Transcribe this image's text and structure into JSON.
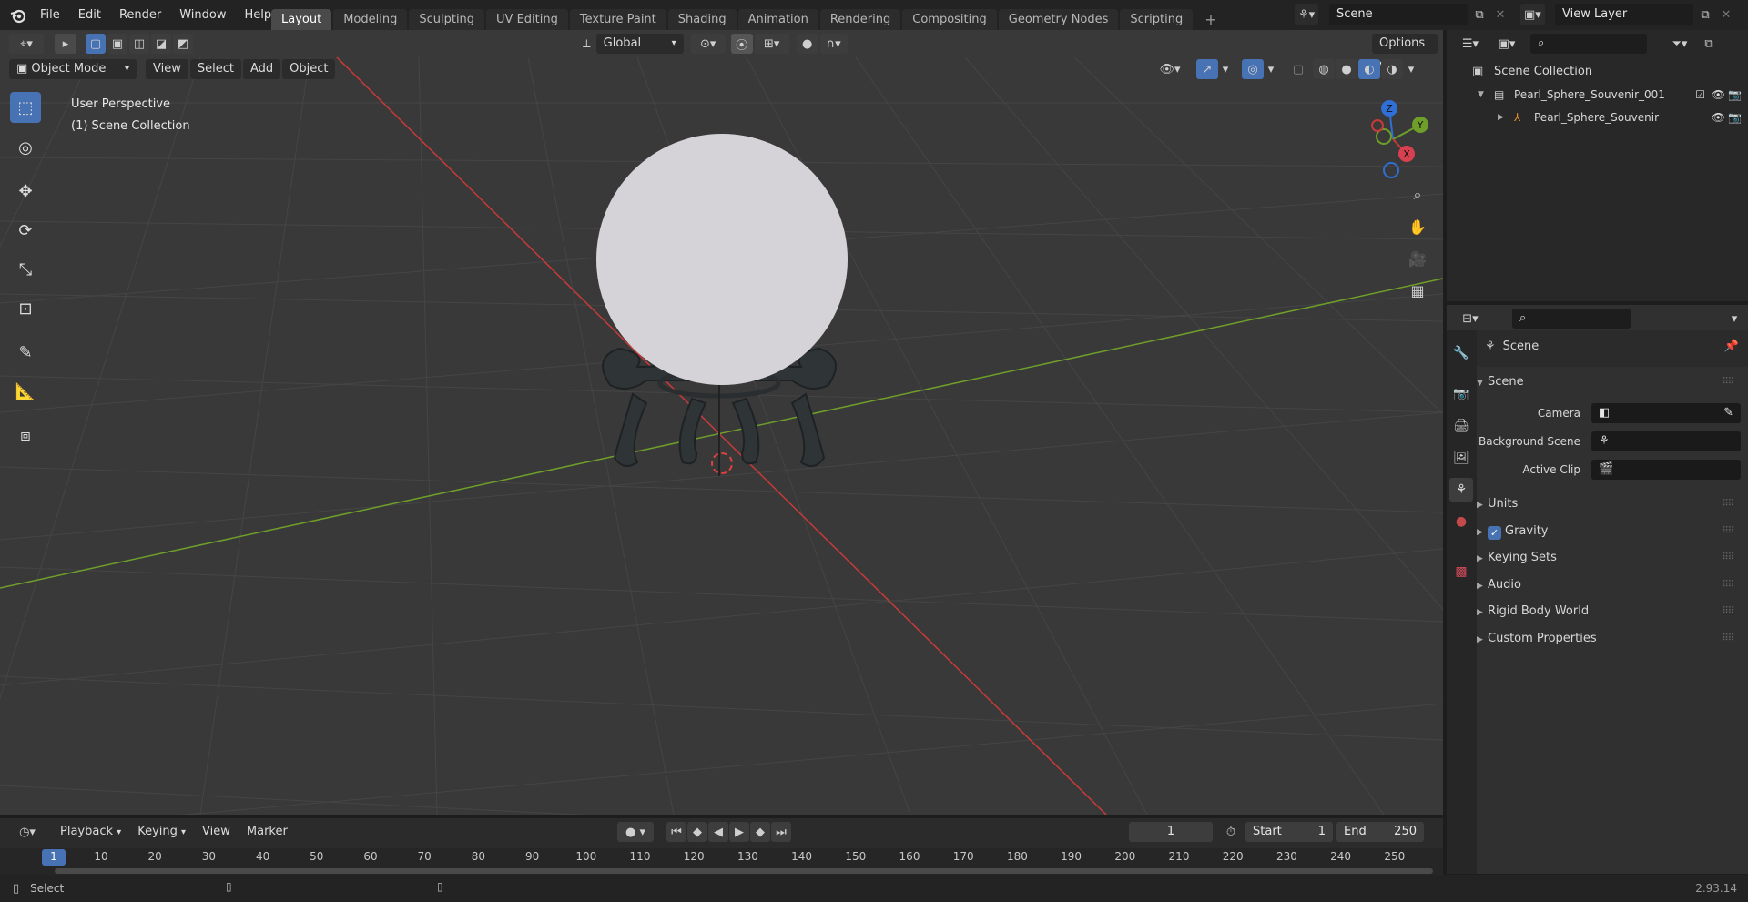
{
  "topbar": {
    "menus": [
      "File",
      "Edit",
      "Render",
      "Window",
      "Help"
    ],
    "workspaces": [
      "Layout",
      "Modeling",
      "Sculpting",
      "UV Editing",
      "Texture Paint",
      "Shading",
      "Animation",
      "Rendering",
      "Compositing",
      "Geometry Nodes",
      "Scripting"
    ],
    "active_workspace": "Layout",
    "add_tab": "+",
    "scene_name": "Scene",
    "view_layer_name": "View Layer"
  },
  "viewport": {
    "mode": "Object Mode",
    "menus": [
      "View",
      "Select",
      "Add",
      "Object"
    ],
    "transform_orientation": "Global",
    "options_label": "Options",
    "overlay_line1": "User Perspective",
    "overlay_line2": "(1) Scene Collection",
    "gizmo_axes": [
      "Z",
      "Y",
      "X"
    ]
  },
  "outliner": {
    "root": "Scene Collection",
    "items": [
      {
        "label": "Pearl_Sphere_Souvenir_001"
      },
      {
        "label": "Pearl_Sphere_Souvenir"
      }
    ]
  },
  "properties": {
    "context": "Scene",
    "panel_title": "Scene",
    "camera_label": "Camera",
    "background_scene_label": "Background Scene",
    "active_clip_label": "Active Clip",
    "sections": [
      "Units",
      "Gravity",
      "Keying Sets",
      "Audio",
      "Rigid Body World",
      "Custom Properties"
    ],
    "gravity_checked": true
  },
  "timeline": {
    "menus": [
      "Playback",
      "Keying",
      "View",
      "Marker"
    ],
    "current_frame": "1",
    "start_label": "Start",
    "start_value": "1",
    "end_label": "End",
    "end_value": "250",
    "ruler": [
      "1",
      "10",
      "20",
      "30",
      "40",
      "50",
      "60",
      "70",
      "80",
      "90",
      "100",
      "110",
      "120",
      "130",
      "140",
      "150",
      "160",
      "170",
      "180",
      "190",
      "200",
      "210",
      "220",
      "230",
      "240",
      "250"
    ]
  },
  "statusbar": {
    "left_hint": "Select",
    "version": "2.93.14"
  },
  "colors": {
    "accent": "#4772b3",
    "x_axis": "#c83a3a",
    "y_axis": "#6f9e2a",
    "z_axis": "#2f6fd6"
  }
}
